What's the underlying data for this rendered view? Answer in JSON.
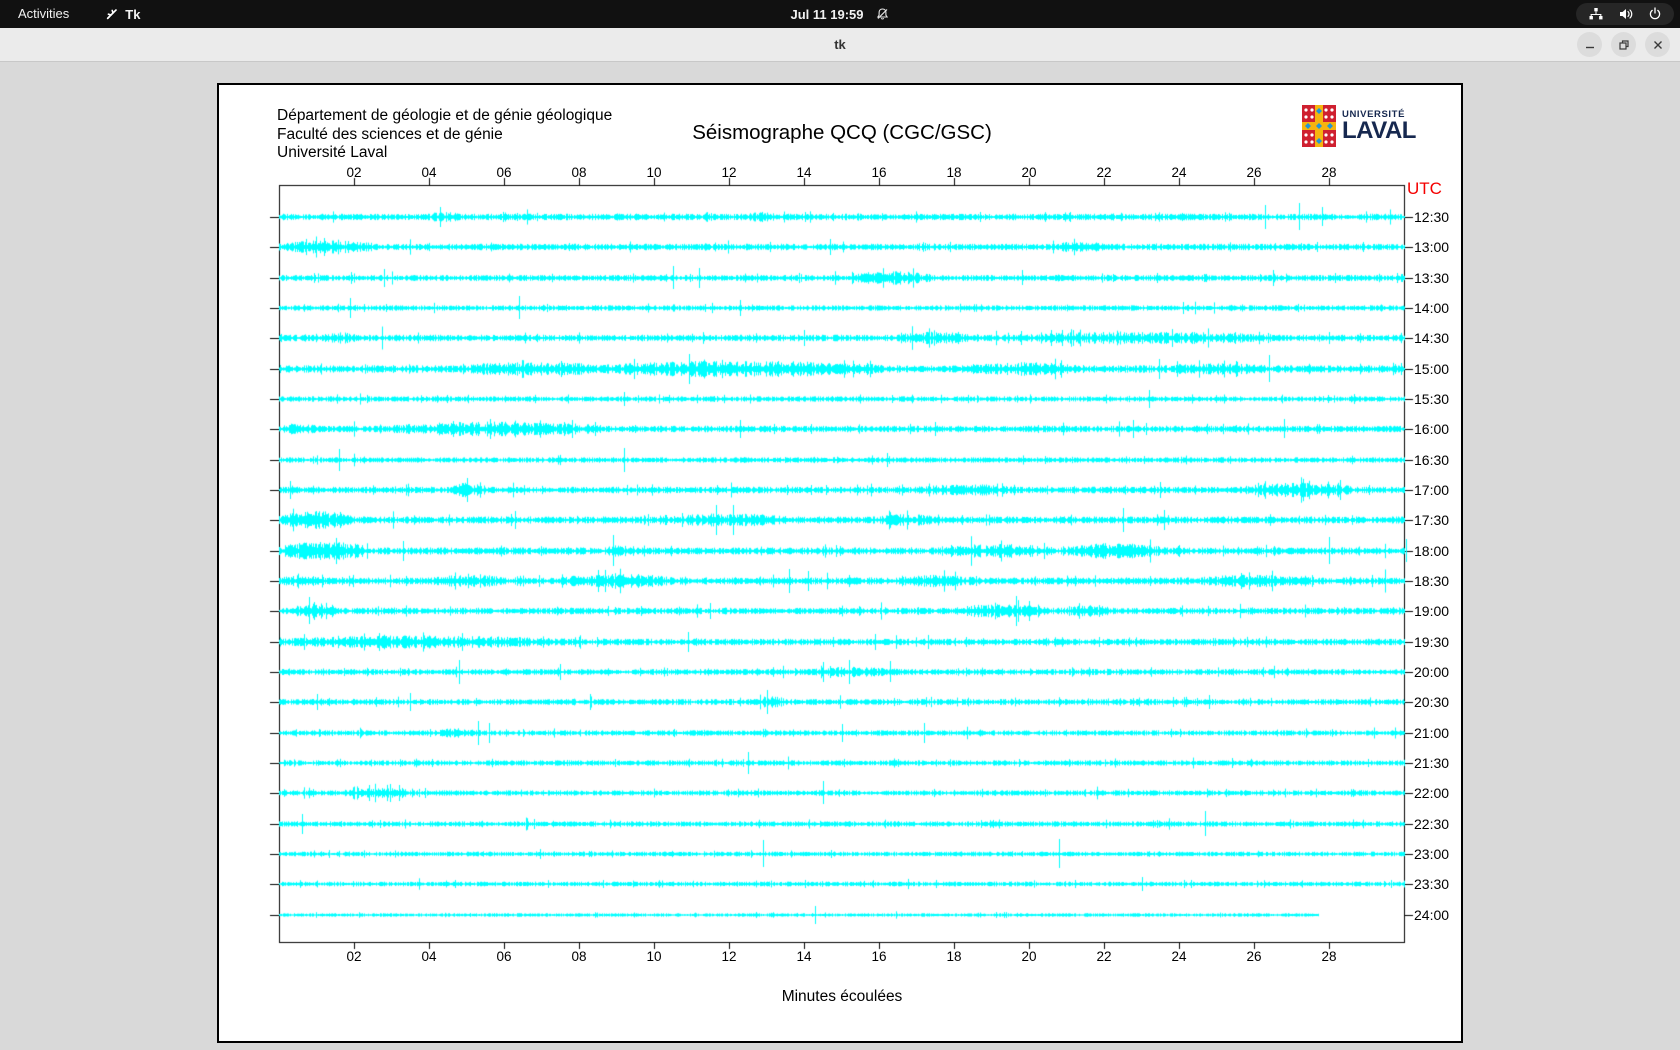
{
  "top_bar": {
    "activities": "Activities",
    "app_name": "Tk",
    "clock": "Jul 11  19:59",
    "status_icons": [
      "network",
      "volume",
      "power"
    ]
  },
  "window": {
    "title": "tk",
    "controls": [
      "minimize",
      "maximize",
      "close"
    ]
  },
  "seismograph": {
    "header_lines": "Département de géologie et de génie géologique\nFaculté des sciences et de génie\nUniversité Laval",
    "title": "Séismographe QCQ (CGC/GSC)",
    "logo": {
      "line1": "UNIVERSITÉ",
      "line2": "LAVAL"
    },
    "utc_label": "UTC",
    "xlabel": "Minutes écoulées",
    "x_ticks": [
      "02",
      "04",
      "06",
      "08",
      "10",
      "12",
      "14",
      "16",
      "18",
      "20",
      "22",
      "24",
      "26",
      "28"
    ],
    "colors": {
      "trace": "#00ffff",
      "axis": "#000000",
      "utc": "#f40000"
    },
    "rows": [
      {
        "label": "12:30",
        "base": 2.2,
        "seed": 11,
        "bursts": [
          [
            4,
            4.8,
            3.8
          ],
          [
            12.4,
            13.4,
            3.4
          ]
        ],
        "spikes": [
          [
            4.3,
            10,
            10
          ],
          [
            26.3,
            12,
            12
          ],
          [
            27.2,
            14,
            13
          ],
          [
            27.8,
            10,
            9
          ]
        ]
      },
      {
        "label": "13:00",
        "base": 2.2,
        "seed": 12,
        "bursts": [
          [
            0,
            2.6,
            4.6
          ],
          [
            20.4,
            22.2,
            3.6
          ]
        ],
        "spikes": [
          [
            14.7,
            8,
            8
          ],
          [
            1.2,
            9,
            9
          ]
        ]
      },
      {
        "label": "13:30",
        "base": 2.0,
        "seed": 13,
        "bursts": [
          [
            15.2,
            17.4,
            4.6
          ]
        ],
        "spikes": [
          [
            2.8,
            9,
            9
          ],
          [
            10.5,
            12,
            11
          ],
          [
            11.2,
            10,
            10
          ],
          [
            19.8,
            8,
            7
          ],
          [
            26.5,
            8,
            8
          ]
        ]
      },
      {
        "label": "14:00",
        "base": 1.8,
        "seed": 14,
        "bursts": [],
        "spikes": [
          [
            1.9,
            10,
            10
          ],
          [
            6.4,
            12,
            11
          ],
          [
            12.3,
            8,
            8
          ],
          [
            24.1,
            6,
            6
          ]
        ]
      },
      {
        "label": "14:30",
        "base": 2.2,
        "seed": 15,
        "bursts": [
          [
            1.1,
            2.1,
            4.0
          ],
          [
            16.4,
            18.6,
            4.2
          ],
          [
            19.4,
            26.6,
            4.4
          ]
        ],
        "spikes": [
          [
            14.0,
            8,
            8
          ]
        ]
      },
      {
        "label": "15:00",
        "base": 2.5,
        "seed": 16,
        "bursts": [
          [
            4.9,
            8.6,
            5.2
          ],
          [
            8.6,
            16.1,
            5.6
          ],
          [
            18.4,
            21.6,
            4.6
          ],
          [
            23.4,
            26.6,
            4.0
          ]
        ],
        "spikes": [
          [
            26.4,
            14,
            13
          ]
        ]
      },
      {
        "label": "15:30",
        "base": 1.8,
        "seed": 17,
        "bursts": [],
        "spikes": [
          [
            9.2,
            7,
            7
          ],
          [
            23.2,
            9,
            9
          ]
        ]
      },
      {
        "label": "16:00",
        "base": 2.2,
        "seed": 18,
        "bursts": [
          [
            0,
            1.1,
            4.0
          ],
          [
            3,
            8.6,
            5.0
          ]
        ],
        "spikes": [
          [
            12.3,
            9,
            9
          ],
          [
            17.5,
            7,
            7
          ],
          [
            26.8,
            10,
            9
          ]
        ]
      },
      {
        "label": "16:30",
        "base": 1.8,
        "seed": 19,
        "bursts": [],
        "spikes": [
          [
            1.6,
            11,
            11
          ],
          [
            9.2,
            12,
            12
          ],
          [
            16.2,
            7,
            7
          ]
        ]
      },
      {
        "label": "17:00",
        "base": 2.2,
        "seed": 20,
        "bursts": [
          [
            4.6,
            5.4,
            5.0
          ],
          [
            17,
            19.6,
            4.0
          ],
          [
            25.7,
            28.6,
            5.0
          ]
        ],
        "spikes": [
          [
            0.3,
            9,
            9
          ],
          [
            5.0,
            12,
            12
          ],
          [
            23.5,
            8,
            8
          ],
          [
            28.3,
            10,
            10
          ]
        ]
      },
      {
        "label": "17:30",
        "base": 2.4,
        "seed": 21,
        "bursts": [
          [
            0,
            1.9,
            6.0
          ],
          [
            10.4,
            13.6,
            4.6
          ],
          [
            15.9,
            17.6,
            4.0
          ]
        ],
        "spikes": [
          [
            6.3,
            9,
            9
          ],
          [
            22.5,
            12,
            12
          ],
          [
            23.6,
            10,
            10
          ]
        ]
      },
      {
        "label": "18:00",
        "base": 2.4,
        "seed": 22,
        "bursts": [
          [
            0,
            2.4,
            6.4
          ],
          [
            8.7,
            9.4,
            4.0
          ],
          [
            17.7,
            20.6,
            5.0
          ],
          [
            21,
            23.6,
            5.4
          ]
        ],
        "spikes": [
          [
            3.3,
            10,
            10
          ],
          [
            8.9,
            16,
            15
          ],
          [
            28.0,
            14,
            13
          ],
          [
            30.05,
            12,
            11
          ]
        ]
      },
      {
        "label": "18:30",
        "base": 2.4,
        "seed": 23,
        "bursts": [
          [
            0,
            1.3,
            4.0
          ],
          [
            4,
            6.1,
            4.2
          ],
          [
            7.4,
            10.6,
            5.0
          ],
          [
            16.4,
            18.6,
            4.4
          ],
          [
            24.4,
            27.6,
            4.4
          ]
        ],
        "spikes": [
          [
            13.6,
            12,
            12
          ],
          [
            14.1,
            10,
            10
          ]
        ]
      },
      {
        "label": "19:00",
        "base": 2.2,
        "seed": 24,
        "bursts": [
          [
            0.4,
            1.6,
            6.0
          ],
          [
            17.9,
            20.6,
            4.6
          ],
          [
            21,
            22.1,
            4.0
          ]
        ],
        "spikes": [
          [
            0.8,
            14,
            13
          ],
          [
            11.5,
            8,
            8
          ],
          [
            20.0,
            10,
            10
          ]
        ]
      },
      {
        "label": "19:30",
        "base": 2.2,
        "seed": 25,
        "bursts": [
          [
            0,
            7.6,
            4.4
          ]
        ],
        "spikes": [
          [
            10.9,
            10,
            10
          ],
          [
            15.9,
            8,
            8
          ]
        ]
      },
      {
        "label": "20:00",
        "base": 2.0,
        "seed": 26,
        "bursts": [
          [
            13.9,
            16.6,
            3.6
          ]
        ],
        "spikes": [
          [
            4.8,
            12,
            12
          ],
          [
            7.5,
            8,
            8
          ],
          [
            14.5,
            10,
            10
          ],
          [
            15.2,
            12,
            12
          ],
          [
            16.3,
            11,
            10
          ]
        ]
      },
      {
        "label": "20:30",
        "base": 2.0,
        "seed": 27,
        "bursts": [
          [
            12.7,
            13.5,
            4.0
          ]
        ],
        "spikes": [
          [
            1.0,
            8,
            8
          ],
          [
            3.5,
            9,
            9
          ],
          [
            8.3,
            8,
            8
          ],
          [
            13.0,
            12,
            12
          ],
          [
            24.8,
            7,
            7
          ]
        ]
      },
      {
        "label": "21:00",
        "base": 1.8,
        "seed": 28,
        "bursts": [
          [
            4.1,
            5.3,
            3.2
          ]
        ],
        "spikes": [
          [
            5.3,
            12,
            12
          ],
          [
            5.6,
            10,
            10
          ],
          [
            15.0,
            9,
            9
          ],
          [
            17.2,
            10,
            10
          ]
        ]
      },
      {
        "label": "21:30",
        "base": 1.8,
        "seed": 29,
        "bursts": [],
        "spikes": [
          [
            12.5,
            11,
            11
          ],
          [
            25.4,
            5,
            5
          ]
        ]
      },
      {
        "label": "22:00",
        "base": 1.8,
        "seed": 30,
        "bursts": [
          [
            1.7,
            3.5,
            4.0
          ]
        ],
        "spikes": [
          [
            2.4,
            8,
            8
          ],
          [
            3.2,
            8,
            8
          ],
          [
            14.5,
            12,
            11
          ]
        ]
      },
      {
        "label": "22:30",
        "base": 1.8,
        "seed": 31,
        "bursts": [],
        "spikes": [
          [
            0.6,
            10,
            10
          ],
          [
            6.8,
            5,
            5
          ],
          [
            24.7,
            13,
            12
          ]
        ]
      },
      {
        "label": "23:00",
        "base": 1.6,
        "seed": 32,
        "bursts": [],
        "spikes": [
          [
            12.9,
            14,
            13
          ],
          [
            20.8,
            15,
            14
          ]
        ]
      },
      {
        "label": "23:30",
        "base": 1.6,
        "seed": 33,
        "bursts": [],
        "spikes": [
          [
            23.0,
            7,
            7
          ]
        ]
      },
      {
        "label": "24:00",
        "base": 1.2,
        "seed": 34,
        "end": 27.7,
        "bursts": [],
        "spikes": [
          [
            14.3,
            9,
            9
          ]
        ]
      }
    ]
  }
}
